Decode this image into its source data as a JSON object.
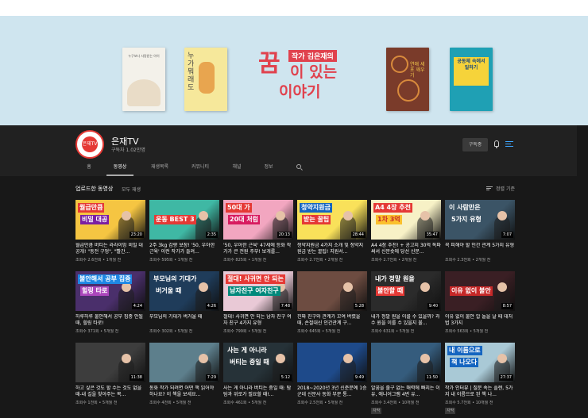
{
  "banner": {
    "logo_top": "작가 김은재의",
    "logo_main": "꿈",
    "logo_mid": "이 있는",
    "logo_bottom": "이야기",
    "book1_text": "누구보다 사랑받는 아이",
    "book2_text": "누가 뭐래도",
    "book3_text": "연애 세포 깨우기",
    "book4_text": "공동체 속에서 일하기"
  },
  "channel": {
    "name": "은재TV",
    "subscribers": "구독자 1.02만명",
    "avatar_text": "은재TV",
    "subscribe_label": "구독중"
  },
  "tabs": [
    {
      "label": "홈"
    },
    {
      "label": "동영상"
    },
    {
      "label": "재생목록"
    },
    {
      "label": "커뮤니티"
    },
    {
      "label": "채널"
    },
    {
      "label": "정보"
    }
  ],
  "section": {
    "title": "업로드한 동영상",
    "play_all": "모두 재생",
    "sort_label": "정렬 기준"
  },
  "videos": [
    {
      "title": "월급만큼 버티는 라라이밍 비밀 대공개! \"동전 구멍\", \"빨간...",
      "meta": "조회수 2.6천회 • 1개월 전",
      "duration": "23:20",
      "thumb1": "월급만큼",
      "thumb2": "비밀 대공",
      "bg": "#f5c542",
      "t1bg": "#e53935",
      "t1c": "#ffffff",
      "t2bg": "#7b1fa2",
      "t2c": "#ffffff",
      "badge": ""
    },
    {
      "title": "2주 3kg 감량 보장! '50, 우아한 근육' 이런 작가가 들려...",
      "meta": "조회수 595회 • 1개월 전",
      "duration": "2:35",
      "thumb1": "",
      "thumb2": "운동 BEST 3",
      "bg": "#3fb8a4",
      "t1bg": "transparent",
      "t1c": "#ffffff",
      "t2bg": "#e53935",
      "t2c": "#ffffff",
      "badge": ""
    },
    {
      "title": "'50, 우아한 근육' 47세에 등화 작가가 큰 전원 주부! 보개를...",
      "meta": "조회수 825회 • 1개월 전",
      "duration": "20:13",
      "thumb1": "50대 가",
      "thumb2": "20대 처럼",
      "bg": "#f2a6c0",
      "t1bg": "#e53935",
      "t1c": "#ffffff",
      "t2bg": "#d81b60",
      "t2c": "#ffffff",
      "badge": ""
    },
    {
      "title": "청약지원금 4가지 소개 및 청약지원금 받는 꿀팁! 지원서...",
      "meta": "조회수 2.7천회 • 2개월 전",
      "duration": "28:44",
      "thumb1": "청약지원금",
      "thumb2": "받는 꿀팁",
      "bg": "#f9e15a",
      "t1bg": "#1565c0",
      "t1c": "#ffffff",
      "t2bg": "#e53935",
      "t2c": "#ffffff",
      "badge": ""
    },
    {
      "title": "A4 4장 추천! + 공고지 30억 독파 써서 신문숏에 당선 신문...",
      "meta": "조회수 2.7천회 • 2개월 전",
      "duration": "35:47",
      "thumb1": "A4 4장 추천",
      "thumb2": "1차 3억",
      "bg": "#f7f1c6",
      "t1bg": "#e53935",
      "t1c": "#ffffff",
      "t2bg": "#fbc02d",
      "t2c": "#c62828",
      "badge": ""
    },
    {
      "title": "꼭 피해야 할 인간 관계 5가지 유형",
      "meta": "조회수 2.3천회 • 2개월 전",
      "duration": "7:07",
      "thumb1": "이 사람만은",
      "thumb2": "5가지 유형",
      "bg": "#3b5466",
      "t1bg": "transparent",
      "t1c": "#ffffff",
      "t2bg": "transparent",
      "t2c": "#ffffff",
      "badge": ""
    },
    {
      "title": "하루하루 불안해서 공부 집중 안될 때, 힐링 타로!",
      "meta": "조회수 371회 • 5개월 전",
      "duration": "4:24",
      "thumb1": "불안해서 공부 집중",
      "thumb2": "힐링 타로",
      "bg": "#4a2f6b",
      "t1bg": "#1e88e5",
      "t1c": "#ffffff",
      "t2bg": "#ab47bc",
      "t2c": "#ffffff",
      "badge": ""
    },
    {
      "title": "부모님의 기대가 버거울 때",
      "meta": "조회수 302회 • 5개월 전",
      "duration": "4:26",
      "thumb1": "부모님의 기대가",
      "thumb2": "버거울 때",
      "bg": "#1f3c5a",
      "t1bg": "transparent",
      "t1c": "#ffffff",
      "t2bg": "transparent",
      "t2c": "#ffffff",
      "badge": ""
    },
    {
      "title": "절대! 사귀면 안 되는 남자 친구 여자 친구 4가지 유형",
      "meta": "조회수 799회 • 5개월 전",
      "duration": "7:48",
      "thumb1": "절대! 사귀면 안 되는",
      "thumb2": "남자친구 여자친구",
      "bg": "#e9c9d6",
      "t1bg": "#e53935",
      "t1c": "#ffffff",
      "t2bg": "#00897b",
      "t2c": "#ffffff",
      "badge": ""
    },
    {
      "title": "진짜 친구와 관계가 꼬여 버렸을 때, 손절대신 인간관계 구...",
      "meta": "조회수 645회 • 5개월 전",
      "duration": "5:28",
      "thumb1": "",
      "thumb2": "",
      "bg": "#6d4c41",
      "t1bg": "transparent",
      "t1c": "#ffffff",
      "t2bg": "transparent",
      "t2c": "#ffffff",
      "badge": ""
    },
    {
      "title": "내가 정말 원을 이룰 수 있을까? 과수 원을 이룰 수 있을지 불...",
      "meta": "조회수 631회 • 5개월 전",
      "duration": "9:40",
      "thumb1": "내가 정말 원을",
      "thumb2": "불안할 때",
      "bg": "#2b2b2b",
      "t1bg": "transparent",
      "t1c": "#ffffff",
      "t2bg": "#e53935",
      "t2c": "#ffffff",
      "badge": ""
    },
    {
      "title": "이유 없이 불안 압 놀을 날 때 대처법 3가지",
      "meta": "조회수 563회 • 5개월 전",
      "duration": "8:57",
      "thumb1": "",
      "thumb2": "이유 없이 불안",
      "bg": "#3a1f24",
      "t1bg": "transparent",
      "t1c": "#ffffff",
      "t2bg": "#c62828",
      "t2c": "#ffffff",
      "badge": ""
    },
    {
      "title": "하고 싶은 것도 할 수는 것도 없을 때-내 길을 찾아주는 목...",
      "meta": "조회수 1천회 • 5개월 전",
      "duration": "11:38",
      "thumb1": "",
      "thumb2": "",
      "bg": "#3d3d3d",
      "t1bg": "transparent",
      "t1c": "#ffffff",
      "t2bg": "transparent",
      "t2c": "#ffffff",
      "badge": ""
    },
    {
      "title": "동화 작가 되려면 어떤 책 읽어야 하나요? 이 책을 보세요...",
      "meta": "조회수 4천회 • 5개월 전",
      "duration": "7:29",
      "thumb1": "",
      "thumb2": "",
      "bg": "#5d7f8c",
      "t1bg": "transparent",
      "t1c": "#ffffff",
      "t2bg": "transparent",
      "t2c": "#ffffff",
      "badge": ""
    },
    {
      "title": "사는 게 아니라 버티는 중일 때: 탐탐과 위로가 필요할 때!...",
      "meta": "조회수 461회 • 5개월 전",
      "duration": "5:12",
      "thumb1": "사는 게 아니라",
      "thumb2": "버티는 중일 때",
      "bg": "#263238",
      "t1bg": "transparent",
      "t1c": "#ffffff",
      "t2bg": "transparent",
      "t2c": "#ffffff",
      "badge": ""
    },
    {
      "title": "2018~2020년 3년 신춘문예 1승군데 신문사 동화 부문 통...",
      "meta": "조회수 2.5천회 • 5개월 전",
      "duration": "9:49",
      "thumb1": "",
      "thumb2": "",
      "bg": "#1e4a8a",
      "t1bg": "transparent",
      "t1c": "#ffffff",
      "t2bg": "transparent",
      "t2c": "#ffffff",
      "badge": ""
    },
    {
      "title": "알꿈을 줄구 없는 매력에 빠지는 이유, 애니어그램 4번 유...",
      "meta": "조회수 3.4천회 • 10개월 전",
      "duration": "11:50",
      "thumb1": "",
      "thumb2": "",
      "bg": "#355c7d",
      "t1bg": "transparent",
      "t1c": "#ffffff",
      "t2bg": "transparent",
      "t2c": "#ffffff",
      "badge": "자막"
    },
    {
      "title": "작가 인터뷰 | 질문 속는 플렌, 5가지 내 이름으로 된 책 나...",
      "meta": "조회수 5.7천회 • 10개월 전",
      "duration": "27:37",
      "thumb1": "내 이름으로",
      "thumb2": "책 나오다",
      "bg": "#a9c9d6",
      "t1bg": "#1565c0",
      "t1c": "#ffffff",
      "t2bg": "#1565c0",
      "t2c": "#ffffff",
      "badge": "자막"
    }
  ]
}
